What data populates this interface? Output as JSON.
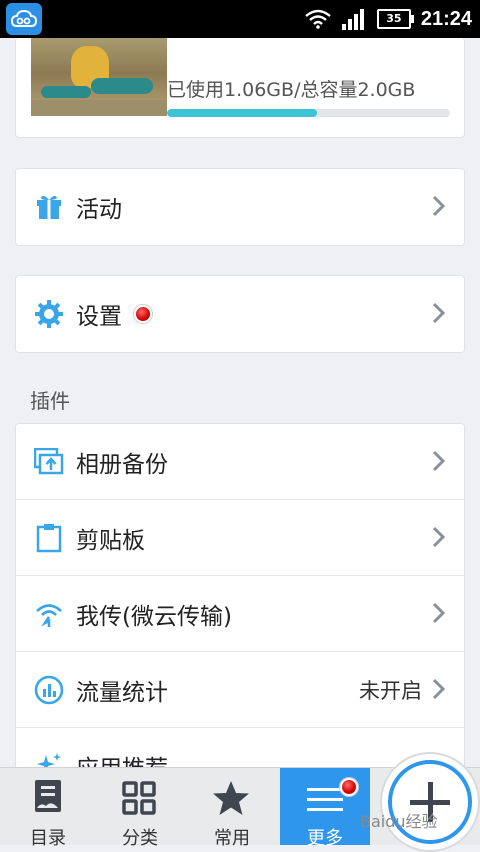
{
  "status_bar": {
    "time": "21:24",
    "battery": "35"
  },
  "storage": {
    "text": "已使用1.06GB/总容量2.0GB",
    "used_fraction": 0.53
  },
  "menu": {
    "activity": "活动",
    "settings": "设置"
  },
  "plugins": {
    "title": "插件",
    "items": [
      {
        "label": "相册备份"
      },
      {
        "label": "剪贴板"
      },
      {
        "label": "我传(微云传输)"
      },
      {
        "label": "流量统计",
        "status": "未开启"
      },
      {
        "label": "应用推荐"
      }
    ]
  },
  "tabbar": {
    "tabs": [
      {
        "label": "目录"
      },
      {
        "label": "分类"
      },
      {
        "label": "常用"
      },
      {
        "label": "更多"
      }
    ]
  },
  "watermark": "Baidu经验",
  "colors": {
    "accent": "#2f96ee",
    "progress": "#3cc4d6",
    "red_dot": "#d40000"
  }
}
